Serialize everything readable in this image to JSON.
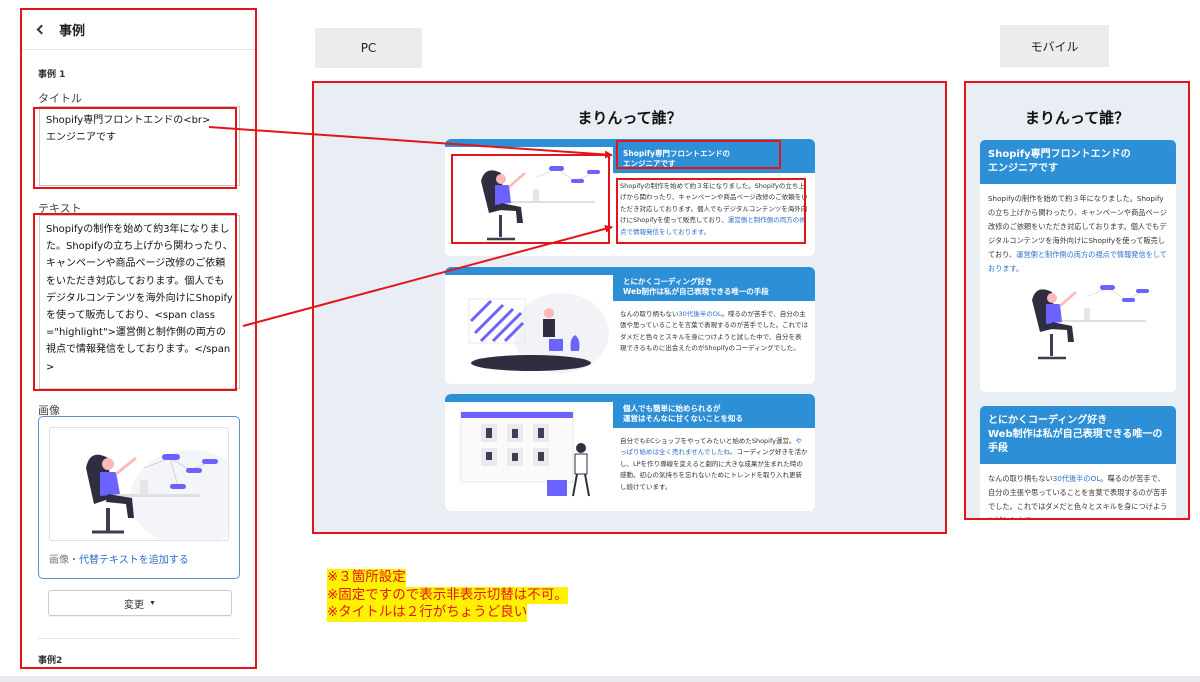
{
  "editor": {
    "header_title": "事例",
    "section1_label": "事例 1",
    "title_label": "タイトル",
    "title_value": "Shopify専門フロントエンドの<br>\nエンジニアです",
    "text_label": "テキスト",
    "text_value": "Shopifyの制作を始めて約3年になりました。Shopifyの立ち上げから関わったり、キャンペーンや商品ページ改修のご依頼をいただき対応しております。個人でもデジタルコンテンツを海外向けにShopifyを使って販売しており、<span class=\"highlight\">運営側と制作側の両方の視点で情報発信をしております。</span>",
    "image_label": "画像",
    "image_caption_prefix": "画像・",
    "image_alt_link": "代替テキストを追加する",
    "change_button": "変更",
    "section2_label": "事例2"
  },
  "tabs": {
    "pc": "PC",
    "mobile": "モバイル"
  },
  "preview": {
    "heading": "まりんって誰？",
    "cards": [
      {
        "title": "Shopify専門フロントエンドの\nエンジニアです",
        "text_plain": "Shopifyの制作を始めて約３年になりました。Shopifyの立ち上げから関わったり、キャンペーンや商品ページ改修のご依頼をいただき対応しております。個人でもデジタルコンテンツを海外向けにShopifyを使って販売しており、",
        "text_highlight": "運営側と制作側の両方の視点で情報発信をしております。"
      },
      {
        "title": "とにかくコーディング好き\nWeb制作は私が自己表現できる唯一の手段",
        "text_a": "なんの取り柄もない",
        "text_highlight": "30代後半のOL",
        "text_b": "。喋るのが苦手で、自分の主張や思っていることを言葉で表現するのが苦手でした。これではダメだと色々とスキルを身につけようと試した中で、自分を表現できるものに出会えたのがShopifyのコーディングでした。"
      },
      {
        "title": "個人でも簡単に始められるが\n運営はそんなに甘くないことを知る",
        "text_a": "自分でもECショップをやってみたいと始めたShopify運営。",
        "text_highlight": "やっぱり始めは全く売れませんでしたね。",
        "text_b": "コーディング好きを活かし、LPを作り導線を変えると劇的に大きな成果が生まれた時の感動。初心の気持ちを忘れないためにトレンドを取り入れ更新し続けています。"
      }
    ],
    "mobile_card1_title": "Shopify専門フロントエンドの\nエンジニアです",
    "mobile_card1_text": "Shopifyの制作を始めて約３年になりました。Shopifyの立ち上げから関わったり、キャンペーンや商品ページ改修のご依頼をいただき対応しております。個人でもデジタルコンテンツを海外向けにShopifyを使って販売しており、",
    "mobile_card1_highlight": "運営側と制作側の両方の視点で情報発信をしております。",
    "mobile_card2_title": "とにかくコーディング好き\nWeb制作は私が自己表現できる唯一の手段",
    "mobile_card2_text_a": "なんの取り柄もない",
    "mobile_card2_highlight": "30代後半のOL",
    "mobile_card2_text_b": "。喋るのが苦手で、自分の主張や思っていることを言葉で表現するのが苦手でした。これではダメだと色々とスキルを身につけようと試した中で、"
  },
  "notes": [
    "※３箇所設定",
    "※固定ですので表示非表示切替は不可。",
    "※タイトルは２行がちょうど良い"
  ],
  "colors": {
    "annotation_red": "#e4141b",
    "accent_blue": "#2d8fd5",
    "highlight_yellow": "#fff200",
    "illustration_purple": "#6c63ff"
  }
}
